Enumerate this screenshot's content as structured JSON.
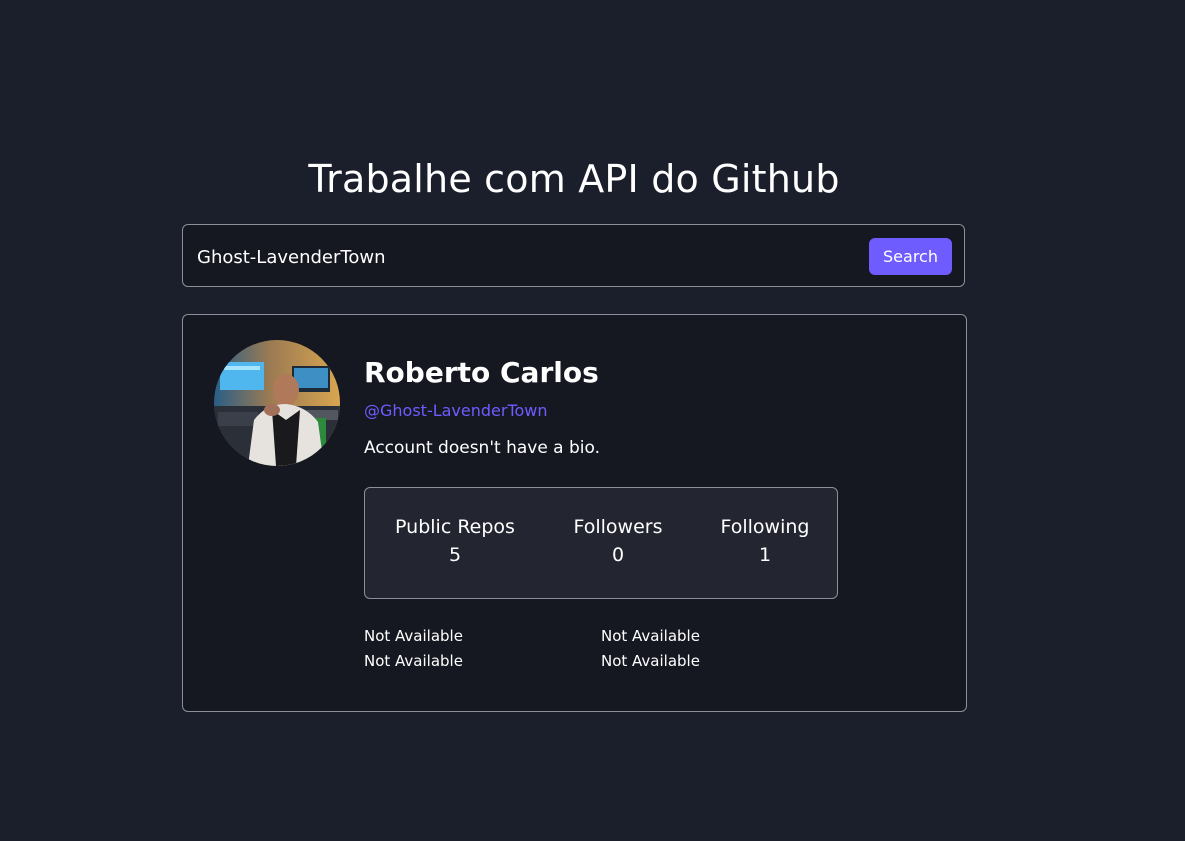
{
  "header": {
    "title": "Trabalhe com API do Github"
  },
  "search": {
    "value": "Ghost-LavenderTown",
    "button_label": "Search"
  },
  "profile": {
    "name": "Roberto Carlos",
    "login": "@Ghost-LavenderTown",
    "bio": "Account doesn't have a bio.",
    "stats": [
      {
        "label": "Public Repos",
        "value": "5"
      },
      {
        "label": "Followers",
        "value": "0"
      },
      {
        "label": "Following",
        "value": "1"
      }
    ],
    "links": [
      "Not Available",
      "Not Available",
      "Not Available",
      "Not Available"
    ]
  },
  "colors": {
    "background": "#1b1f2b",
    "card": "#151821",
    "accent": "#6e5cff",
    "border": "#8b8f98"
  }
}
